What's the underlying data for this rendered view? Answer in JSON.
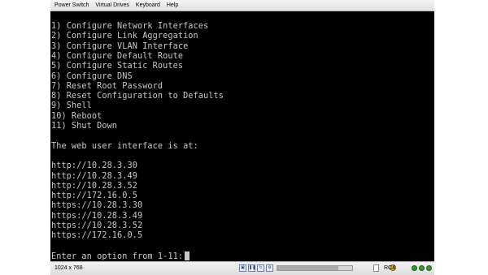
{
  "menu": [
    "Power Switch",
    "Virtual Drives",
    "Keyboard",
    "Help"
  ],
  "console_lines": [
    "1) Configure Network Interfaces",
    "2) Configure Link Aggregation",
    "3) Configure VLAN Interface",
    "4) Configure Default Route",
    "5) Configure Static Routes",
    "6) Configure DNS",
    "7) Reset Root Password",
    "8) Reset Configuration to Defaults",
    "9) Shell",
    "10) Reboot",
    "11) Shut Down",
    "",
    "The web user interface is at:",
    "",
    "http://10.28.3.30",
    "http://10.28.3.49",
    "http://10.28.3.52",
    "http://172.16.0.5",
    "https://10.28.3.30",
    "https://10.28.3.49",
    "https://10.28.3.52",
    "https://172.16.0.5",
    "",
    "Enter an option from 1-11:"
  ],
  "status": {
    "resolution": "1024 x 768",
    "server": "RC4",
    "progress_fraction": 0.82,
    "leds": [
      "#2e9e2e",
      "#2e9e2e",
      "#2e9e2e"
    ]
  }
}
